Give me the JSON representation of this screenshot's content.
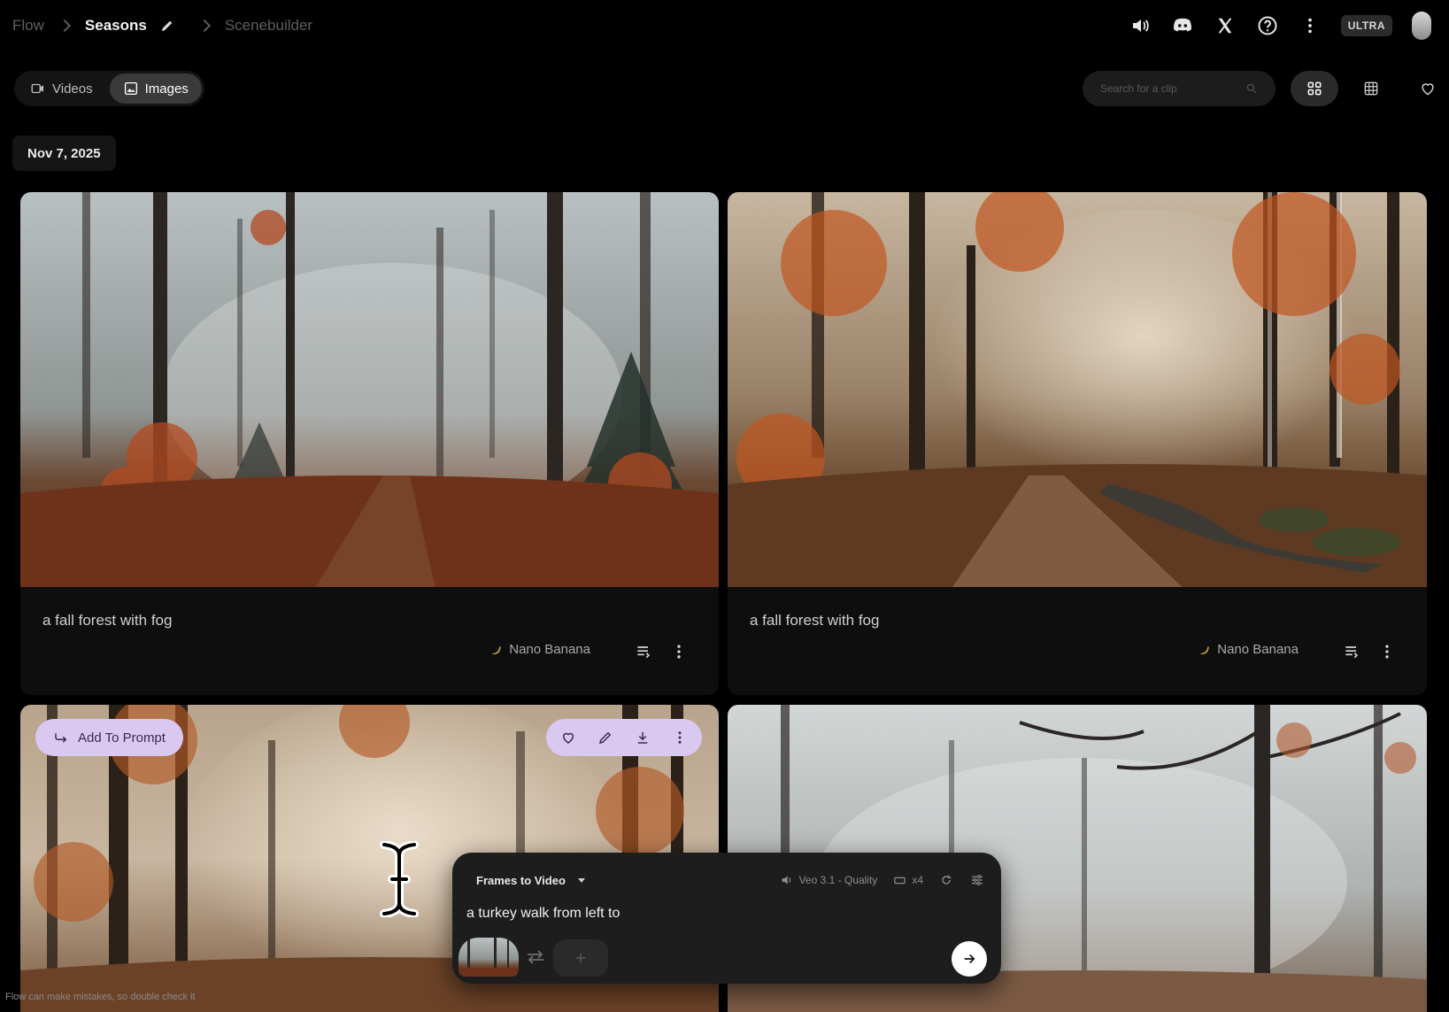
{
  "breadcrumb": {
    "root": "Flow",
    "project": "Seasons",
    "page": "Scenebuilder"
  },
  "top_actions": {
    "badge": "ULTRA",
    "icons": [
      "volume-icon",
      "discord-icon",
      "x-logo-icon",
      "help-icon",
      "more-vert-icon",
      "avatar"
    ]
  },
  "tabs": [
    {
      "label": "Videos",
      "active": false
    },
    {
      "label": "Images",
      "active": true
    }
  ],
  "search": {
    "placeholder": "Search for a clip",
    "value": ""
  },
  "view_modes": [
    "grid-large",
    "grid-small",
    "favorites"
  ],
  "date_group": "Nov 7, 2025",
  "cards": [
    {
      "prompt": "a fall forest with fog",
      "model": "Nano Banana"
    },
    {
      "prompt": "a fall forest with fog",
      "model": "Nano Banana"
    },
    {
      "hover": {
        "add_to_prompt": "Add To Prompt"
      }
    },
    {}
  ],
  "composer": {
    "mode": "Frames to Video",
    "model_label": "Veo 3.1 - Quality",
    "count": "x4",
    "input_value": "a turkey walk from left to"
  },
  "disclaimer": "Flow can make mistakes, so double check it",
  "colors": {
    "background": "#000000",
    "accent_pill": "#d9c8f0",
    "card_meta": "#0e0e0e"
  }
}
